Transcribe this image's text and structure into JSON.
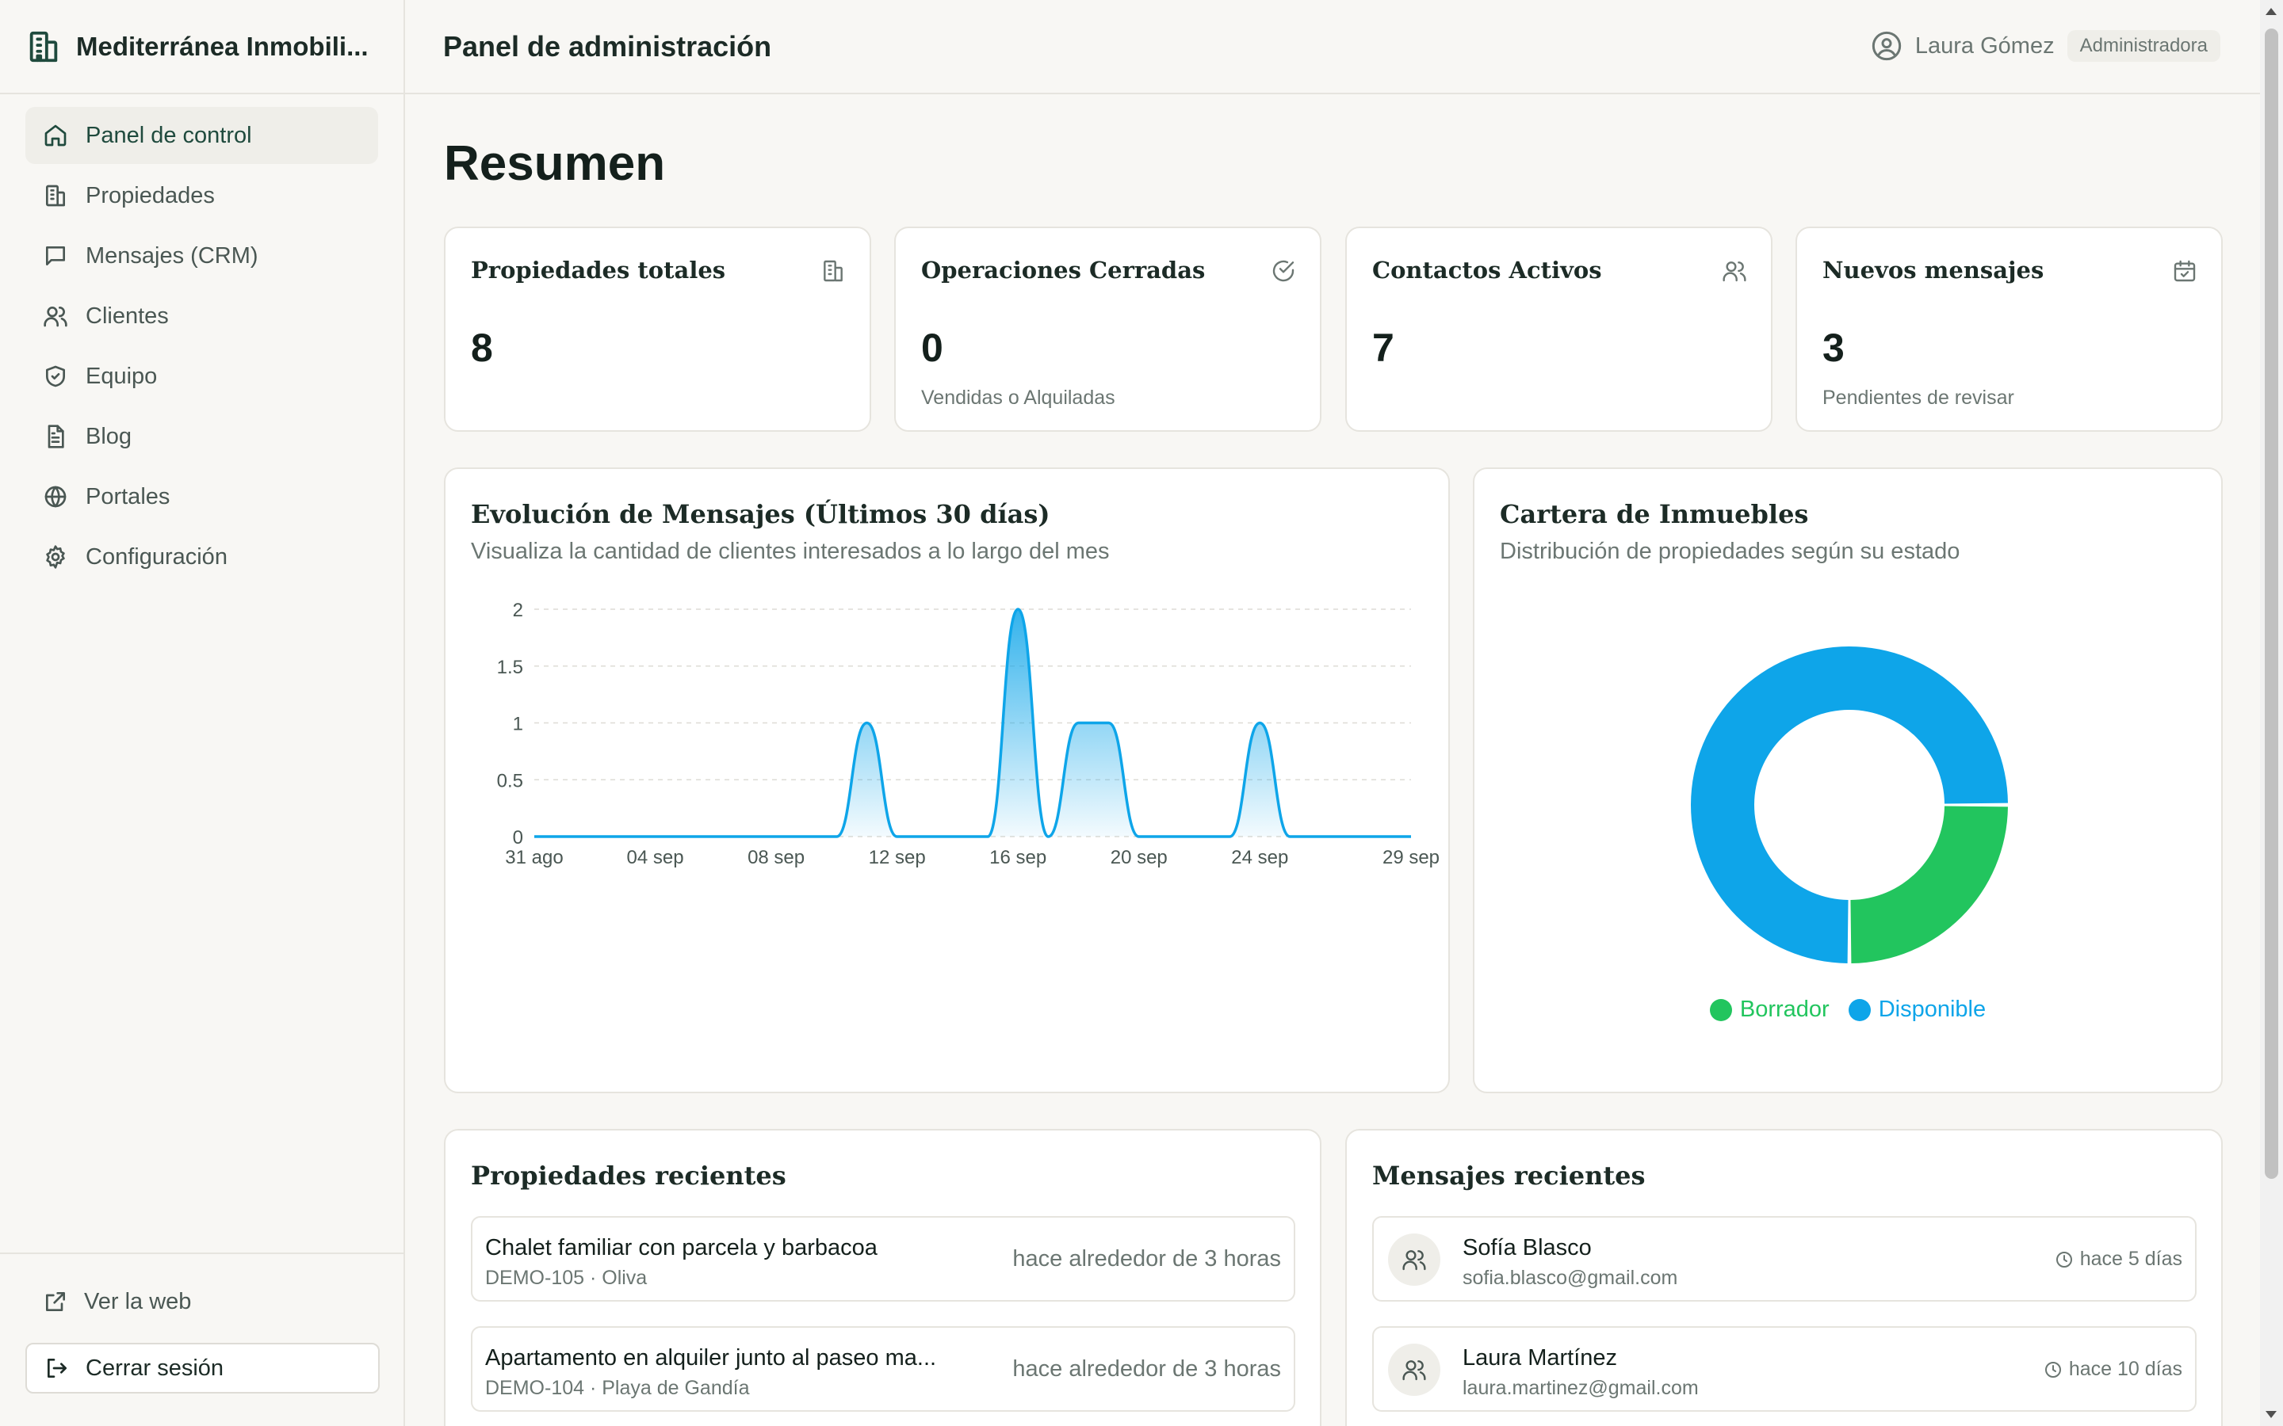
{
  "brand": {
    "name": "Mediterránea Inmobili..."
  },
  "sidebar": {
    "items": [
      {
        "label": "Panel de control",
        "icon": "home-icon",
        "active": true
      },
      {
        "label": "Propiedades",
        "icon": "building-icon"
      },
      {
        "label": "Mensajes (CRM)",
        "icon": "message-icon"
      },
      {
        "label": "Clientes",
        "icon": "users-icon"
      },
      {
        "label": "Equipo",
        "icon": "shield-icon"
      },
      {
        "label": "Blog",
        "icon": "document-icon"
      },
      {
        "label": "Portales",
        "icon": "globe-icon"
      },
      {
        "label": "Configuración",
        "icon": "gear-icon"
      }
    ],
    "view_site": "Ver la web",
    "logout": "Cerrar sesión"
  },
  "header": {
    "title": "Panel de administración",
    "user_name": "Laura Gómez",
    "user_role": "Administradora"
  },
  "main": {
    "title": "Resumen",
    "stats": [
      {
        "title": "Propiedades totales",
        "value": "8",
        "sub": "",
        "icon": "building-icon"
      },
      {
        "title": "Operaciones Cerradas",
        "value": "0",
        "sub": "Vendidas o Alquiladas",
        "icon": "check-circle-icon"
      },
      {
        "title": "Contactos Activos",
        "value": "7",
        "sub": "",
        "icon": "users-icon"
      },
      {
        "title": "Nuevos mensajes",
        "value": "3",
        "sub": "Pendientes de revisar",
        "icon": "calendar-icon"
      }
    ],
    "messages_chart": {
      "title": "Evolución de Mensajes (Últimos 30 días)",
      "subtitle": "Visualiza la cantidad de clientes interesados a lo largo del mes"
    },
    "portfolio_chart": {
      "title": "Cartera de Inmuebles",
      "subtitle": "Distribución de propiedades según su estado"
    },
    "recent_properties": {
      "title": "Propiedades recientes",
      "items": [
        {
          "title": "Chalet familiar con parcela y barbacoa",
          "meta": "DEMO-105 · Oliva",
          "time": "hace alrededor de 3 horas"
        },
        {
          "title": "Apartamento en alquiler junto al paseo ma...",
          "meta": "DEMO-104 · Playa de Gandía",
          "time": "hace alrededor de 3 horas"
        }
      ]
    },
    "recent_messages": {
      "title": "Mensajes recientes",
      "items": [
        {
          "name": "Sofía Blasco",
          "email": "sofia.blasco@gmail.com",
          "time": "hace 5 días"
        },
        {
          "name": "Laura Martínez",
          "email": "laura.martinez@gmail.com",
          "time": "hace 10 días"
        }
      ]
    }
  },
  "colors": {
    "accent": "#1f4a3d",
    "line": "#0ea5e9",
    "green": "#22c55e",
    "blue": "#0ea5e9"
  },
  "chart_data": [
    {
      "type": "area",
      "title": "Evolución de Mensajes (Últimos 30 días)",
      "subtitle": "Visualiza la cantidad de clientes interesados a lo largo del mes",
      "x": [
        "31 ago",
        "01 sep",
        "02 sep",
        "03 sep",
        "04 sep",
        "05 sep",
        "06 sep",
        "07 sep",
        "08 sep",
        "09 sep",
        "10 sep",
        "11 sep",
        "12 sep",
        "13 sep",
        "14 sep",
        "15 sep",
        "16 sep",
        "17 sep",
        "18 sep",
        "19 sep",
        "20 sep",
        "21 sep",
        "22 sep",
        "23 sep",
        "24 sep",
        "25 sep",
        "26 sep",
        "27 sep",
        "28 sep",
        "29 sep"
      ],
      "values": [
        0,
        0,
        0,
        0,
        0,
        0,
        0,
        0,
        0,
        0,
        0,
        1,
        0,
        0,
        0,
        0,
        2,
        0,
        1,
        1,
        0,
        0,
        0,
        0,
        1,
        0,
        0,
        0,
        0,
        0
      ],
      "xticks": [
        "31 ago",
        "04 sep",
        "08 sep",
        "12 sep",
        "16 sep",
        "20 sep",
        "24 sep",
        "29 sep"
      ],
      "yticks": [
        "0",
        "0.5",
        "1",
        "1.5",
        "2"
      ],
      "ylim": [
        0,
        2
      ],
      "grid": true
    },
    {
      "type": "pie",
      "title": "Cartera de Inmuebles",
      "subtitle": "Distribución de propiedades según su estado",
      "slices": [
        {
          "name": "Borrador",
          "value": 2,
          "color": "#22c55e"
        },
        {
          "name": "Disponible",
          "value": 6,
          "color": "#0ea5e9"
        }
      ],
      "legend": "bottom"
    }
  ]
}
